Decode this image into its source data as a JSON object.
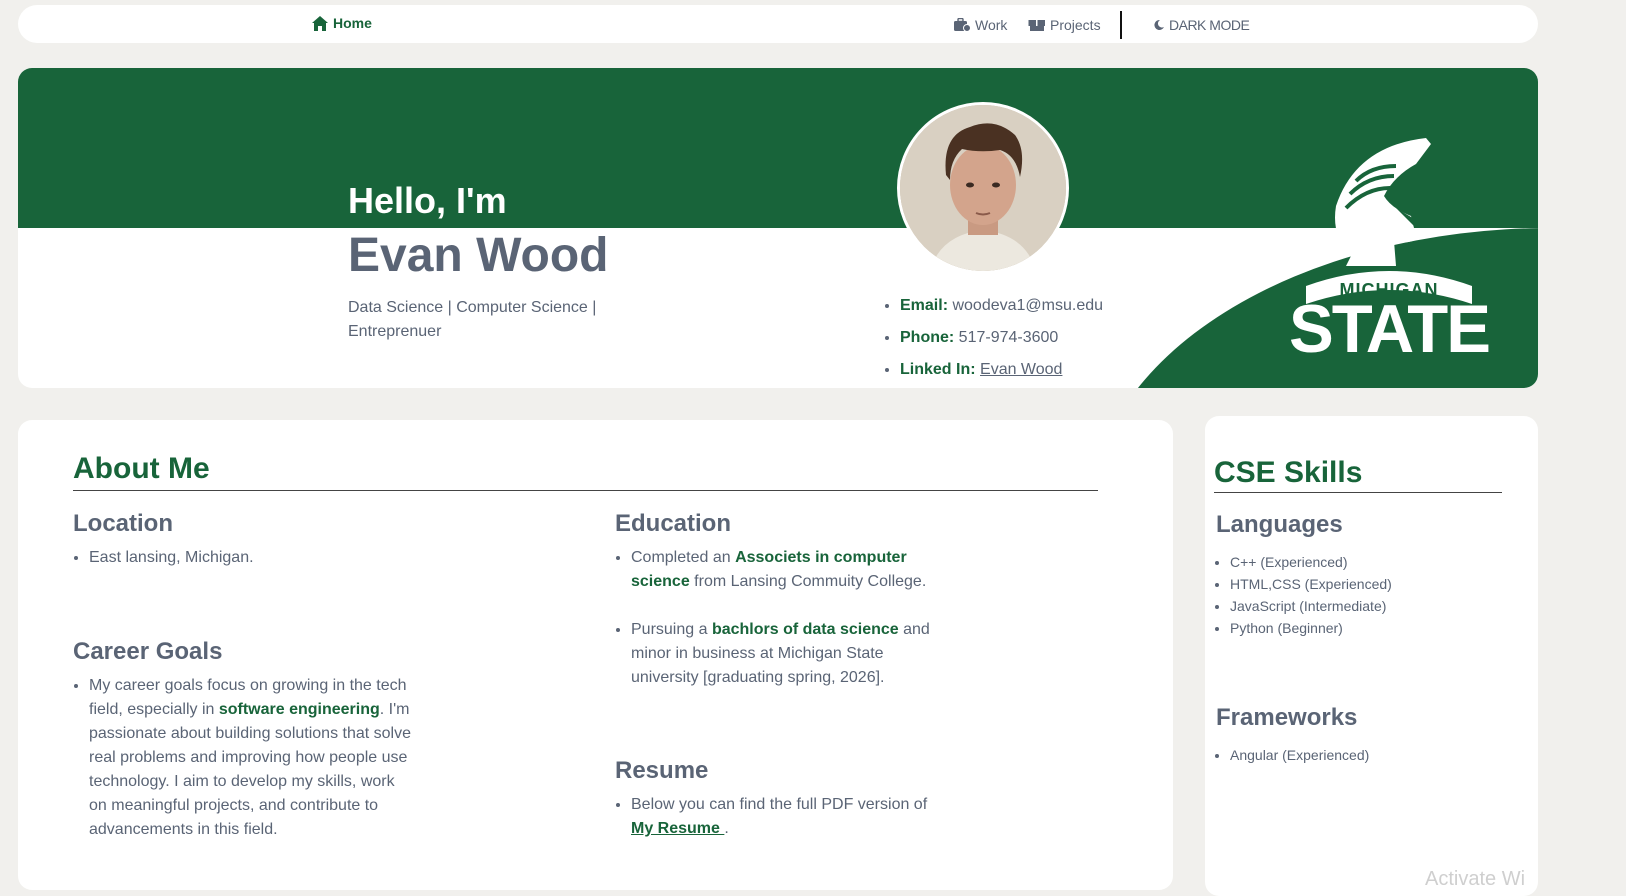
{
  "nav": {
    "home": "Home",
    "work": "Work",
    "projects": "Projects",
    "dark_mode": "DARK MODE"
  },
  "hero": {
    "hello": "Hello, I'm",
    "name": "Evan Wood",
    "tagline": "Data Science | Computer Science | Entreprenuer",
    "contacts": [
      {
        "label": "Email:",
        "value": "woodeva1@msu.edu"
      },
      {
        "label": "Phone:",
        "value": "517-974-3600"
      },
      {
        "label": "Linked In:",
        "value": "Evan Wood"
      }
    ],
    "logo_top": "MICHIGAN",
    "logo_bottom": "STATE"
  },
  "about": {
    "title": "About Me",
    "location": {
      "title": "Location",
      "item": "East lansing, Michigan."
    },
    "career": {
      "title": "Career Goals",
      "pre": "My career goals focus on growing in the tech field, especially in ",
      "highlight": "software engineering",
      "post": ". I'm passionate about building solutions that solve real problems and improving how people use technology. I aim to develop my skills, work on meaningful projects, and contribute to advancements in this field."
    },
    "education": {
      "title": "Education",
      "item1_pre": "Completed an ",
      "item1_highlight": "Associets in computer science",
      "item1_post": " from Lansing Commuity College.",
      "item2_pre": "Pursuing a ",
      "item2_highlight": "bachlors of data science",
      "item2_post": " and minor in business at Michigan State university [graduating spring, 2026]."
    },
    "resume": {
      "title": "Resume",
      "pre": "Below you can find the full PDF version of ",
      "link": "My Resume ",
      "post": "."
    }
  },
  "skills": {
    "title": "CSE Skills",
    "languages_title": "Languages",
    "languages": [
      "C++ (Experienced)",
      "HTML,CSS (Experienced)",
      "JavaScript (Intermediate)",
      "Python (Beginner)"
    ],
    "frameworks_title": "Frameworks",
    "frameworks": [
      "Angular (Experienced)"
    ]
  },
  "colors": {
    "msu_green": "#18643a",
    "text": "#5a6475",
    "background": "#f1f0ed"
  },
  "watermark": "Activate Wi"
}
